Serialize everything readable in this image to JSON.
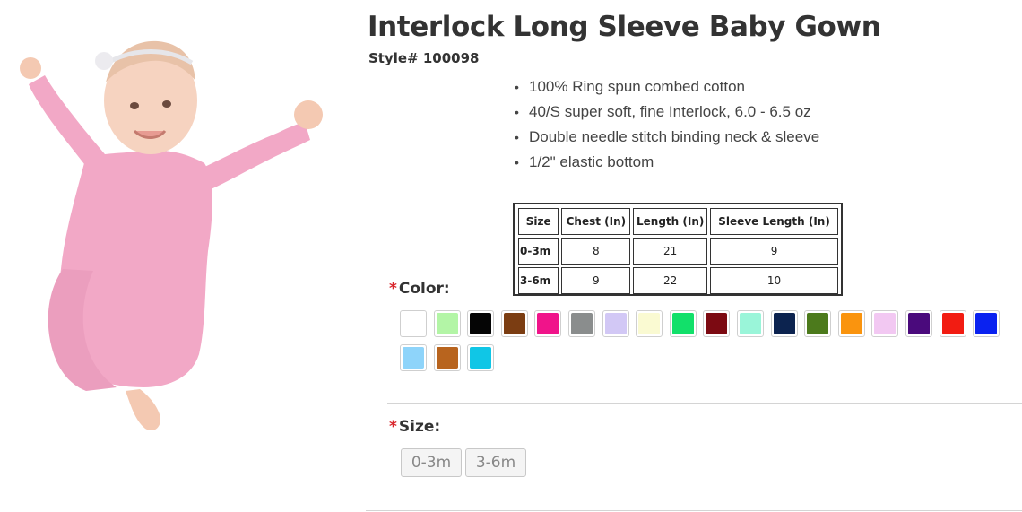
{
  "product": {
    "title": "Interlock Long Sleeve Baby Gown",
    "style": "Style# 100098",
    "features": [
      "100% Ring spun combed cotton",
      "40/S super soft, fine Interlock, 6.0 - 6.5 oz",
      "Double needle stitch binding neck & sleeve",
      "1/2\" elastic bottom"
    ]
  },
  "size_chart": {
    "headers": [
      "Size",
      "Chest (In)",
      "Length (In)",
      "Sleeve Length (In)"
    ],
    "rows": [
      [
        "0-3m",
        "8",
        "21",
        "9"
      ],
      [
        "3-6m",
        "9",
        "22",
        "10"
      ]
    ]
  },
  "color": {
    "label": "Color:",
    "required_mark": "*",
    "swatches": [
      {
        "name": "white",
        "hex": "#ffffff"
      },
      {
        "name": "light-green",
        "hex": "#b3f5a6"
      },
      {
        "name": "black",
        "hex": "#050505"
      },
      {
        "name": "brown",
        "hex": "#7b3d12"
      },
      {
        "name": "hot-pink",
        "hex": "#f0148a"
      },
      {
        "name": "heather-gray",
        "hex": "#8a8d8d"
      },
      {
        "name": "lavender",
        "hex": "#d2c8f5"
      },
      {
        "name": "cream",
        "hex": "#fafad2"
      },
      {
        "name": "kelly-green",
        "hex": "#12e06a"
      },
      {
        "name": "maroon",
        "hex": "#7c0a12"
      },
      {
        "name": "mint",
        "hex": "#9af5d9"
      },
      {
        "name": "navy",
        "hex": "#0c234f"
      },
      {
        "name": "olive",
        "hex": "#4c7a1c"
      },
      {
        "name": "orange",
        "hex": "#fa940e"
      },
      {
        "name": "light-pink",
        "hex": "#f2c8f2"
      },
      {
        "name": "purple",
        "hex": "#4a0a7c"
      },
      {
        "name": "red",
        "hex": "#f21c12"
      },
      {
        "name": "royal-blue",
        "hex": "#0a22f0"
      },
      {
        "name": "light-blue",
        "hex": "#8ed4fa"
      },
      {
        "name": "copper",
        "hex": "#b8641e"
      },
      {
        "name": "turquoise",
        "hex": "#10c6e6"
      }
    ]
  },
  "size": {
    "label": "Size:",
    "required_mark": "*",
    "options": [
      "0-3m",
      "3-6m"
    ]
  }
}
